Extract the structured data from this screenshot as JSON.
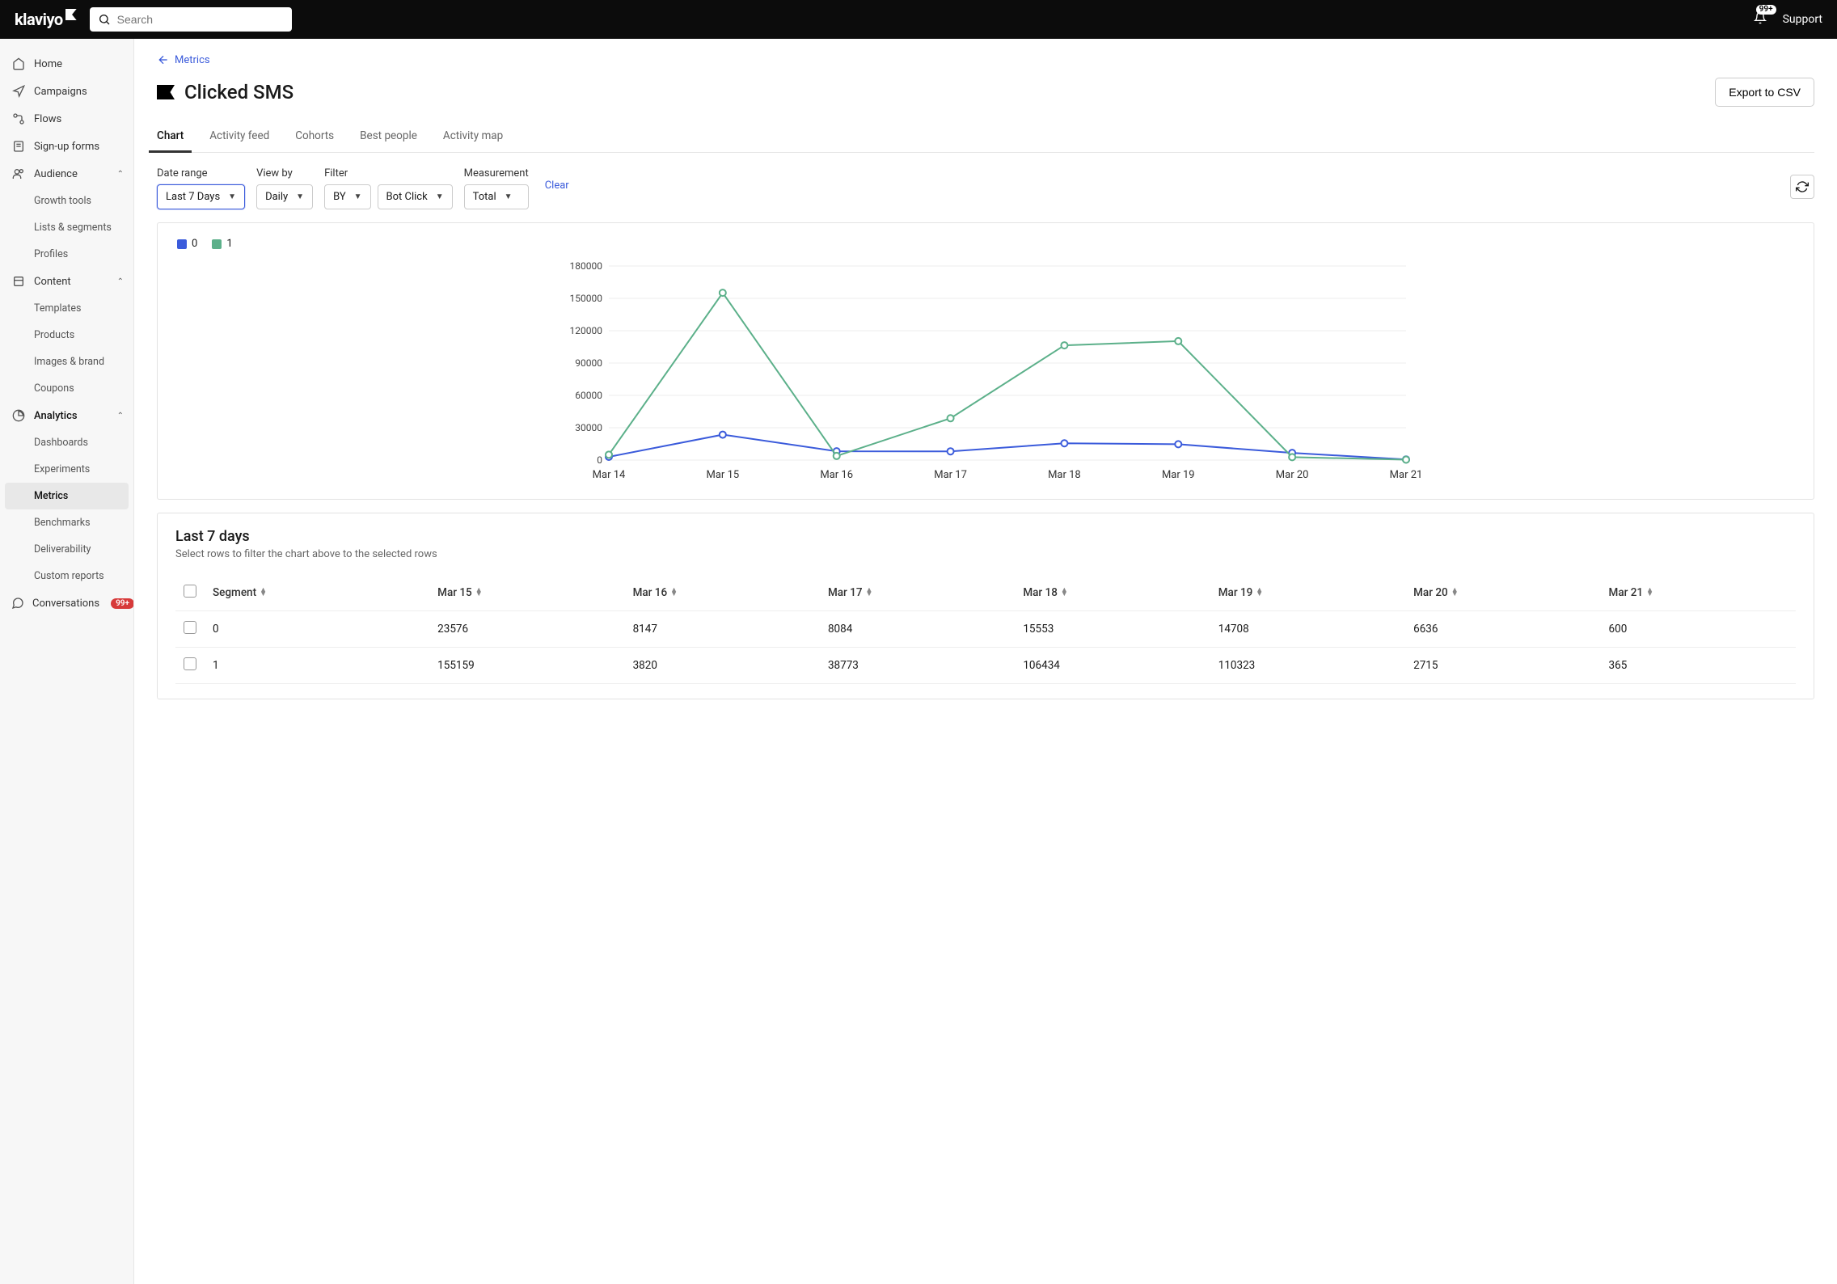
{
  "topbar": {
    "logo": "klaviyo",
    "search_placeholder": "Search",
    "notification_badge": "99+",
    "support": "Support"
  },
  "sidebar": {
    "items": [
      {
        "label": "Home",
        "icon": "home"
      },
      {
        "label": "Campaigns",
        "icon": "send"
      },
      {
        "label": "Flows",
        "icon": "flow"
      },
      {
        "label": "Sign-up forms",
        "icon": "form"
      },
      {
        "label": "Audience",
        "icon": "people",
        "expanded": true,
        "children": [
          {
            "label": "Growth tools"
          },
          {
            "label": "Lists & segments"
          },
          {
            "label": "Profiles"
          }
        ]
      },
      {
        "label": "Content",
        "icon": "content",
        "expanded": true,
        "children": [
          {
            "label": "Templates"
          },
          {
            "label": "Products"
          },
          {
            "label": "Images & brand"
          },
          {
            "label": "Coupons"
          }
        ]
      },
      {
        "label": "Analytics",
        "icon": "analytics",
        "expanded": true,
        "active": true,
        "children": [
          {
            "label": "Dashboards"
          },
          {
            "label": "Experiments"
          },
          {
            "label": "Metrics",
            "active": true
          },
          {
            "label": "Benchmarks"
          },
          {
            "label": "Deliverability"
          },
          {
            "label": "Custom reports"
          }
        ]
      },
      {
        "label": "Conversations",
        "icon": "chat",
        "badge": "99+"
      }
    ]
  },
  "breadcrumb": {
    "back": "Metrics"
  },
  "page": {
    "title": "Clicked SMS",
    "export": "Export to CSV"
  },
  "tabs": [
    "Chart",
    "Activity feed",
    "Cohorts",
    "Best people",
    "Activity map"
  ],
  "active_tab": 0,
  "controls": {
    "date_range": {
      "label": "Date range",
      "value": "Last 7 Days"
    },
    "view_by": {
      "label": "View by",
      "value": "Daily"
    },
    "filter": {
      "label": "Filter",
      "value": "BY",
      "chip": "Bot Click"
    },
    "measurement": {
      "label": "Measurement",
      "value": "Total"
    },
    "clear": "Clear"
  },
  "legend": [
    {
      "name": "0",
      "color": "#3b5bdb"
    },
    {
      "name": "1",
      "color": "#5cb08a"
    }
  ],
  "chart_data": {
    "type": "line",
    "categories": [
      "Mar 14",
      "Mar 15",
      "Mar 16",
      "Mar 17",
      "Mar 18",
      "Mar 19",
      "Mar 20",
      "Mar 21"
    ],
    "ylim": [
      0,
      180000
    ],
    "yticks": [
      0,
      30000,
      60000,
      90000,
      120000,
      150000,
      180000
    ],
    "series": [
      {
        "name": "0",
        "color": "#3b5bdb",
        "values": [
          3000,
          23576,
          8147,
          8084,
          15553,
          14708,
          6636,
          600
        ]
      },
      {
        "name": "1",
        "color": "#5cb08a",
        "values": [
          5000,
          155159,
          3820,
          38773,
          106434,
          110323,
          2715,
          365
        ]
      }
    ]
  },
  "table": {
    "title": "Last 7 days",
    "subtitle": "Select rows to filter the chart above to the selected rows",
    "columns": [
      "Segment",
      "Mar 15",
      "Mar 16",
      "Mar 17",
      "Mar 18",
      "Mar 19",
      "Mar 20",
      "Mar 21"
    ],
    "rows": [
      {
        "segment": "0",
        "cells": [
          "23576",
          "8147",
          "8084",
          "15553",
          "14708",
          "6636",
          "600"
        ]
      },
      {
        "segment": "1",
        "cells": [
          "155159",
          "3820",
          "38773",
          "106434",
          "110323",
          "2715",
          "365"
        ]
      }
    ]
  }
}
